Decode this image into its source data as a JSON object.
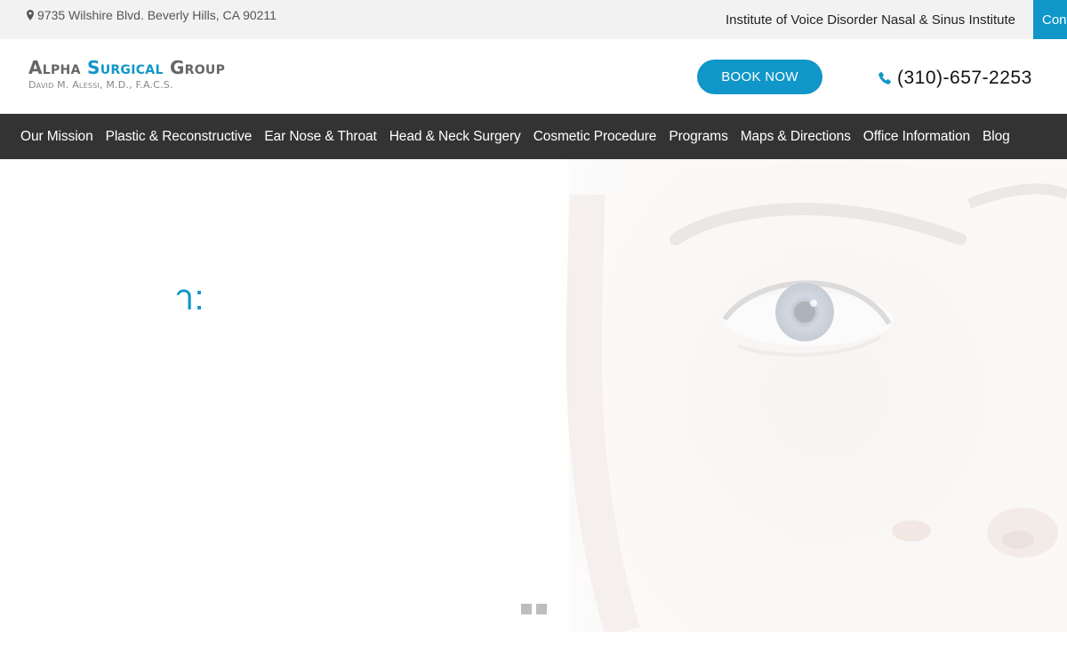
{
  "topbar": {
    "address": "9735 Wilshire Blvd. Beverly Hills, CA 90211",
    "institutes": "Institute of Voice Disorder Nasal & Sinus Institute",
    "contact_tab": "Contact"
  },
  "header": {
    "logo_word1": "Alpha",
    "logo_word2": "Surgical",
    "logo_word3": "Group",
    "logo_sub": "David M. Alessi, M.D., F.A.C.S.",
    "book_label": "BOOK NOW",
    "phone": "(310)-657-2253"
  },
  "nav": {
    "items": [
      {
        "label": "Our Mission"
      },
      {
        "label": "Plastic & Reconstructive"
      },
      {
        "label": "Ear Nose & Throat"
      },
      {
        "label": "Head & Neck Surgery"
      },
      {
        "label": "Cosmetic Procedure"
      },
      {
        "label": "Programs"
      },
      {
        "label": "Maps & Directions"
      },
      {
        "label": "Office Information"
      },
      {
        "label": "Blog"
      }
    ]
  },
  "hero": {
    "heading_fragment": " า:",
    "slides": 2
  },
  "colors": {
    "accent": "#1096c8",
    "nav_bg": "#333333",
    "topbar_bg": "#f2f2f2"
  },
  "icons": {
    "address": "map-pin-icon",
    "phone": "phone-icon"
  }
}
